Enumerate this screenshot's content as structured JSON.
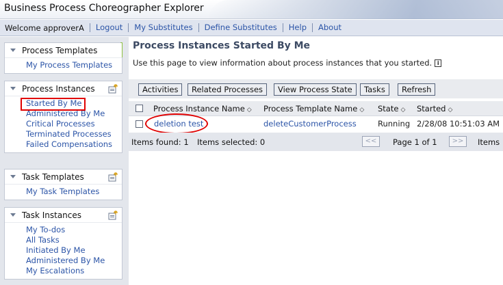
{
  "window": {
    "title": "Business Process Choreographer Explorer"
  },
  "nav": {
    "welcome": "Welcome approverA",
    "links": [
      "Logout",
      "My Substitutes",
      "Define Substitutes",
      "Help",
      "About"
    ]
  },
  "sidebar": {
    "process_templates": {
      "title": "Process Templates",
      "items": [
        "My Process Templates"
      ]
    },
    "process_instances": {
      "title": "Process Instances",
      "items": [
        "Started By Me",
        "Administered By Me",
        "Critical Processes",
        "Terminated Processes",
        "Failed Compensations"
      ]
    },
    "task_templates": {
      "title": "Task Templates",
      "items": [
        "My Task Templates"
      ]
    },
    "task_instances": {
      "title": "Task Instances",
      "items": [
        "My To-dos",
        "All Tasks",
        "Initiated By Me",
        "Administered By Me",
        "My Escalations"
      ]
    }
  },
  "main": {
    "title": "Process Instances Started By Me",
    "description": "Use this page to view information about process instances that you started.",
    "info_icon_char": "i",
    "toolbar": [
      "Activities",
      "Related Processes",
      "View Process State",
      "Tasks",
      "Refresh"
    ],
    "table": {
      "columns": [
        "Process Instance Name",
        "Process Template Name",
        "State",
        "Started"
      ],
      "rows": [
        {
          "instance": "deletion test",
          "template": "deleteCustomerProcess",
          "state": "Running",
          "started": "2/28/08 10:51:03 AM"
        }
      ]
    },
    "footer": {
      "items_found": "Items found: 1",
      "items_selected": "Items selected: 0",
      "prev_btn": "<<",
      "page": "Page 1 of 1",
      "next_btn": ">>",
      "items_trunc": "Items"
    }
  },
  "colors": {
    "link": "#2b54a7",
    "highlight": "#e00000",
    "panel_accent": "#8cbf3f"
  }
}
